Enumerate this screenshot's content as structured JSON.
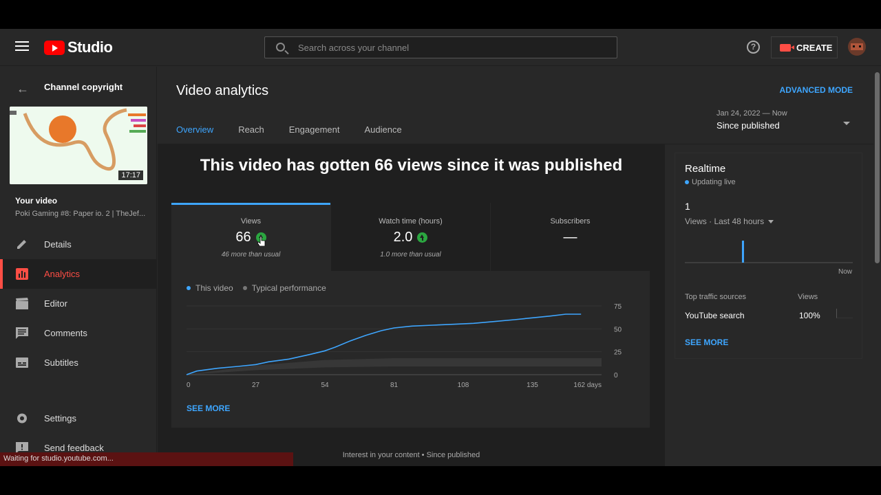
{
  "app": {
    "logo_text": "Studio",
    "brand_color": "#ff0000",
    "accent": "#3ea6ff"
  },
  "search": {
    "placeholder": "Search across your channel"
  },
  "header": {
    "help_icon": "?",
    "create_label": "CREATE"
  },
  "sidebar": {
    "channel_title": "Channel copyright",
    "thumbnail_duration": "17:17",
    "your_video_label": "Your video",
    "video_title": "Poki Gaming #8: Paper io. 2 | TheJef...",
    "items": [
      {
        "label": "Details",
        "icon": "pencil-icon"
      },
      {
        "label": "Analytics",
        "icon": "analytics-icon",
        "active": true
      },
      {
        "label": "Editor",
        "icon": "clapperboard-icon"
      },
      {
        "label": "Comments",
        "icon": "comment-icon"
      },
      {
        "label": "Subtitles",
        "icon": "subtitles-icon"
      },
      {
        "label": "Settings",
        "icon": "gear-icon"
      },
      {
        "label": "Send feedback",
        "icon": "feedback-icon"
      }
    ]
  },
  "main": {
    "title": "Video analytics",
    "advanced_mode": "ADVANCED MODE",
    "date_range": {
      "dates": "Jan 24, 2022 — Now",
      "label": "Since published"
    },
    "tabs": [
      {
        "label": "Overview",
        "active": true
      },
      {
        "label": "Reach"
      },
      {
        "label": "Engagement"
      },
      {
        "label": "Audience"
      }
    ],
    "headline": "This video has gotten 66 views since it was published",
    "metrics": [
      {
        "label": "Views",
        "value": "66",
        "sub": "46 more than usual",
        "trend": "up"
      },
      {
        "label": "Watch time (hours)",
        "value": "2.0",
        "sub": "1.0 more than usual",
        "trend": "up"
      },
      {
        "label": "Subscribers",
        "value": "—",
        "sub": ""
      }
    ],
    "legend": {
      "this_video": "This video",
      "typical": "Typical performance"
    },
    "see_more": "SEE MORE",
    "bottom_caption": "Interest in your content • Since published"
  },
  "realtime": {
    "title": "Realtime",
    "status": "Updating live",
    "value": "1",
    "metric_label": "Views · Last 48 hours",
    "now_label": "Now",
    "traffic_header": "Top traffic sources",
    "views_header": "Views",
    "source": "YouTube search",
    "source_pct": "100%",
    "see_more": "SEE MORE",
    "spike_position": 0.34
  },
  "status_bar": {
    "text": "Waiting for studio.youtube.com..."
  },
  "chart_data": {
    "type": "line",
    "xlabel": "",
    "ylabel": "",
    "x_ticks": [
      "0",
      "27",
      "54",
      "81",
      "108",
      "135",
      "162 days"
    ],
    "y_ticks": [
      "0",
      "25",
      "50",
      "75"
    ],
    "xlim": [
      0,
      162
    ],
    "ylim": [
      0,
      75
    ],
    "series": [
      {
        "name": "This video",
        "color": "#3ea6ff",
        "x": [
          0,
          4,
          12,
          20,
          27,
          32,
          40,
          48,
          54,
          58,
          64,
          70,
          76,
          81,
          88,
          96,
          104,
          112,
          120,
          128,
          135,
          142,
          148,
          154
        ],
        "y": [
          0,
          4,
          7,
          9,
          11,
          14,
          17,
          22,
          26,
          30,
          37,
          43,
          48,
          51,
          53,
          54,
          55,
          56,
          58,
          60,
          62,
          64,
          66,
          66
        ]
      }
    ],
    "typical_band": {
      "name": "Typical performance",
      "x": [
        0,
        27,
        54,
        81,
        108,
        135,
        162
      ],
      "low": [
        0,
        5,
        8,
        9,
        9,
        9,
        9
      ],
      "high": [
        0,
        10,
        16,
        18,
        18,
        18,
        18
      ]
    }
  }
}
